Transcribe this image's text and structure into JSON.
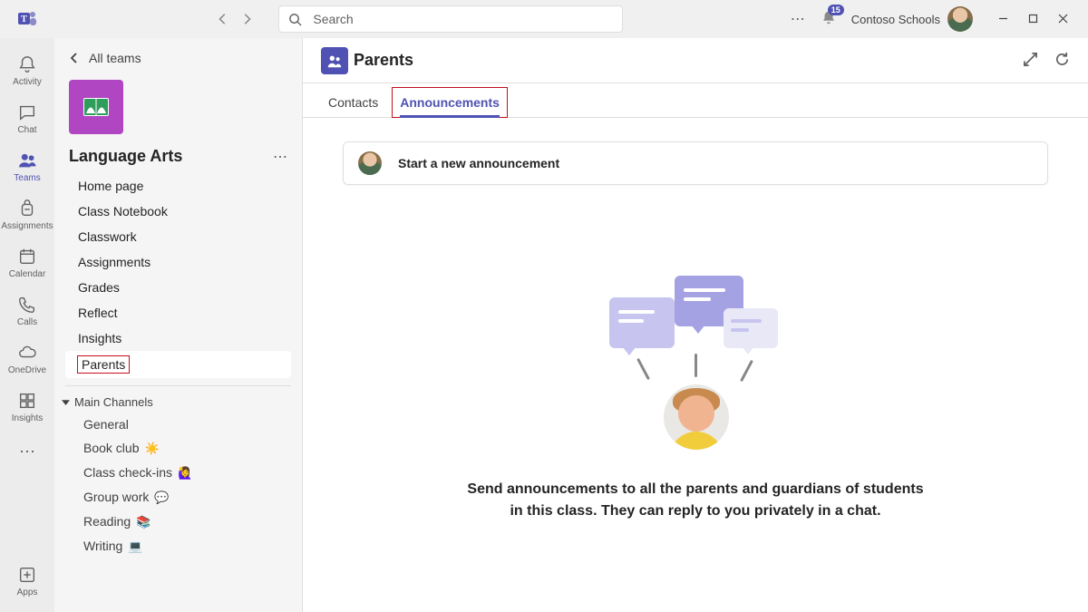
{
  "titlebar": {
    "search_placeholder": "Search",
    "notification_count": "15",
    "tenant_name": "Contoso Schools"
  },
  "rail": {
    "items": [
      {
        "label": "Activity",
        "icon": "bell"
      },
      {
        "label": "Chat",
        "icon": "chat"
      },
      {
        "label": "Teams",
        "icon": "people",
        "active": true
      },
      {
        "label": "Assignments",
        "icon": "backpack"
      },
      {
        "label": "Calendar",
        "icon": "calendar"
      },
      {
        "label": "Calls",
        "icon": "phone"
      },
      {
        "label": "OneDrive",
        "icon": "cloud"
      },
      {
        "label": "Insights",
        "icon": "grid"
      }
    ],
    "apps_label": "Apps"
  },
  "sidebar": {
    "all_teams_label": "All teams",
    "team_name": "Language Arts",
    "nav": [
      {
        "label": "Home page"
      },
      {
        "label": "Class Notebook"
      },
      {
        "label": "Classwork"
      },
      {
        "label": "Assignments"
      },
      {
        "label": "Grades"
      },
      {
        "label": "Reflect"
      },
      {
        "label": "Insights"
      },
      {
        "label": "Parents",
        "active": true,
        "highlight": true
      }
    ],
    "section_label": "Main Channels",
    "channels": [
      {
        "label": "General",
        "emoji": ""
      },
      {
        "label": "Book club",
        "emoji": "☀️"
      },
      {
        "label": "Class check-ins",
        "emoji": "🙋‍♀️"
      },
      {
        "label": "Group work",
        "emoji": "💬"
      },
      {
        "label": "Reading",
        "emoji": "📚"
      },
      {
        "label": "Writing",
        "emoji": "💻"
      }
    ]
  },
  "main": {
    "title": "Parents",
    "tabs": [
      {
        "label": "Contacts",
        "active": false
      },
      {
        "label": "Announcements",
        "active": true,
        "highlight": true
      }
    ],
    "compose_placeholder": "Start a new announcement",
    "empty_message": "Send announcements to all the parents and guardians of students in this class. They can reply to you privately in a chat."
  }
}
